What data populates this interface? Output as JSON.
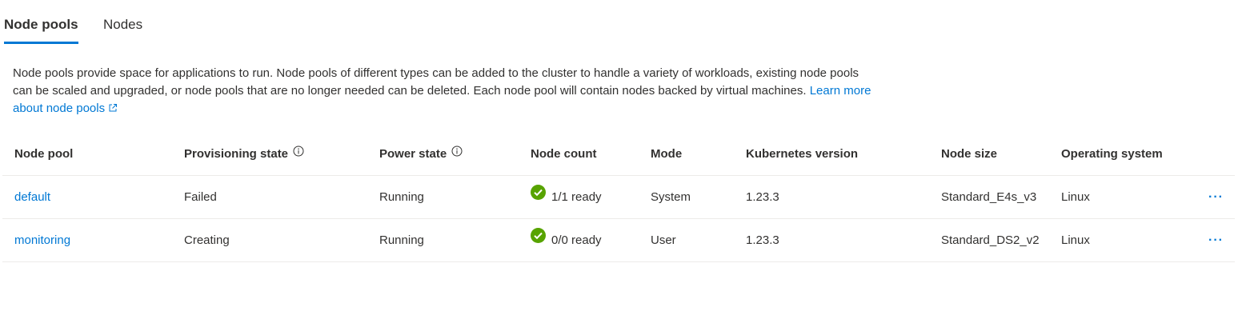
{
  "tabs": [
    {
      "label": "Node pools",
      "active": true
    },
    {
      "label": "Nodes",
      "active": false
    }
  ],
  "description": {
    "text": "Node pools provide space for applications to run. Node pools of different types can be added to the cluster to handle a variety of workloads, existing node pools can be scaled and upgraded, or node pools that are no longer needed can be deleted. Each node pool will contain nodes backed by virtual machines.",
    "link_label": "Learn more about node pools",
    "link_icon": "external-link-icon"
  },
  "table": {
    "columns": {
      "node_pool": "Node pool",
      "provisioning_state": "Provisioning state",
      "power_state": "Power state",
      "node_count": "Node count",
      "mode": "Mode",
      "kubernetes_version": "Kubernetes version",
      "node_size": "Node size",
      "operating_system": "Operating system"
    },
    "rows": [
      {
        "node_pool": "default",
        "provisioning_state": "Failed",
        "power_state": "Running",
        "node_count": "1/1 ready",
        "node_count_icon": "check-circle-icon",
        "mode": "System",
        "kubernetes_version": "1.23.3",
        "node_size": "Standard_E4s_v3",
        "operating_system": "Linux",
        "more": "···"
      },
      {
        "node_pool": "monitoring",
        "provisioning_state": "Creating",
        "power_state": "Running",
        "node_count": "0/0 ready",
        "node_count_icon": "check-circle-icon",
        "mode": "User",
        "kubernetes_version": "1.23.3",
        "node_size": "Standard_DS2_v2",
        "operating_system": "Linux",
        "more": "···"
      }
    ]
  },
  "colors": {
    "accent": "#0078d4",
    "success": "#57a300",
    "text": "#323130",
    "divider": "#edebe9"
  }
}
